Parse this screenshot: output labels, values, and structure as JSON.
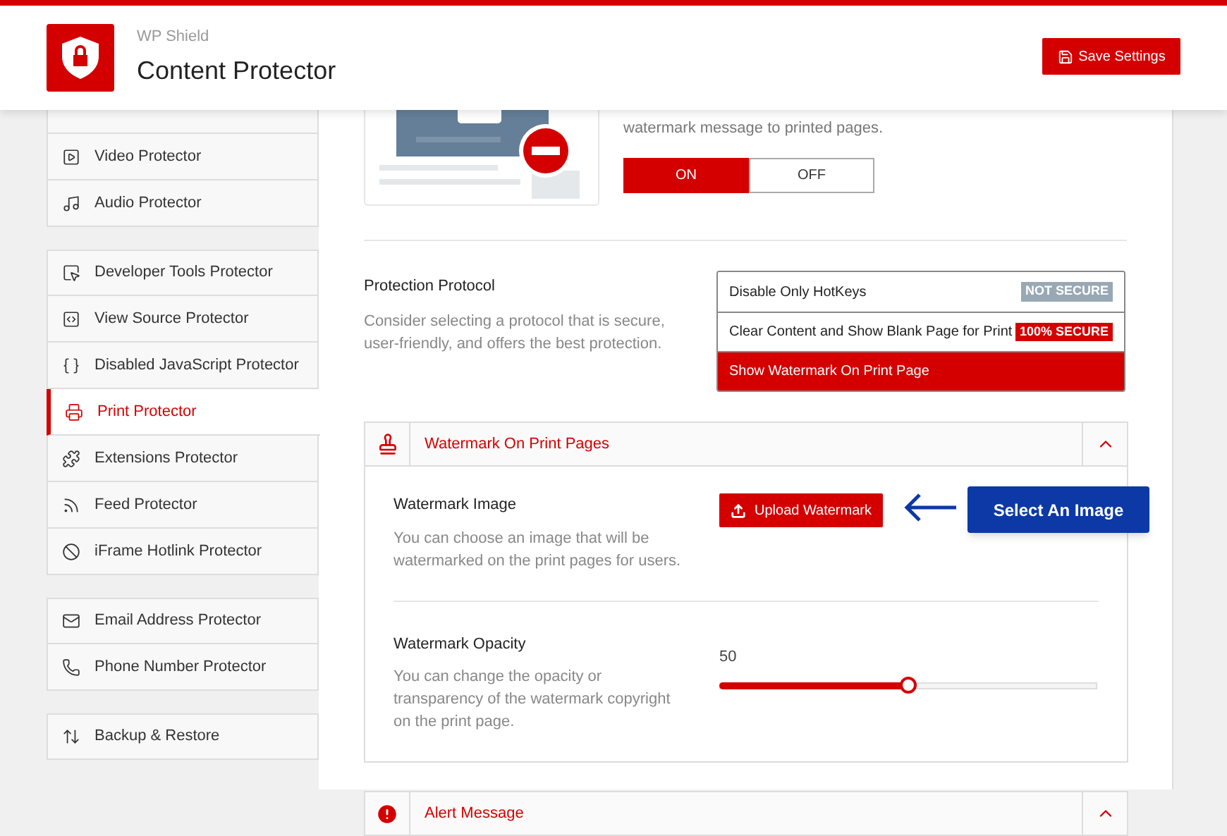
{
  "header": {
    "brand": "WP Shield",
    "title": "Content Protector",
    "save_button": "Save Settings"
  },
  "sidebar": {
    "groups": [
      [
        {
          "label": "Video Protector",
          "selected": false
        },
        {
          "label": "Audio Protector",
          "selected": false
        }
      ],
      [
        {
          "label": "Developer Tools Protector",
          "selected": false
        },
        {
          "label": "View Source Protector",
          "selected": false
        },
        {
          "label": "Disabled JavaScript Protector",
          "selected": false
        },
        {
          "label": "Print Protector",
          "selected": true
        },
        {
          "label": "Extensions Protector",
          "selected": false
        },
        {
          "label": "Feed Protector",
          "selected": false
        },
        {
          "label": "iFrame Hotlink Protector",
          "selected": false
        }
      ],
      [
        {
          "label": "Email Address Protector",
          "selected": false
        },
        {
          "label": "Phone Number Protector",
          "selected": false
        }
      ],
      [
        {
          "label": "Backup & Restore",
          "selected": false
        }
      ]
    ]
  },
  "print_feature": {
    "description": "watermark message to printed pages.",
    "toggle": [
      {
        "label": "ON",
        "selected": true
      },
      {
        "label": "OFF",
        "selected": false
      }
    ]
  },
  "protection_protocol": {
    "title": "Protection Protocol",
    "description": "Consider selecting a protocol that is secure, user-friendly, and offers the best protection.",
    "options": [
      {
        "label": "Disable Only HotKeys",
        "badge": "NOT SECURE",
        "kind": "not-secure",
        "selected": false
      },
      {
        "label": "Clear Content and Show Blank Page for Print",
        "badge": "100% SECURE",
        "kind": "secure",
        "selected": false
      },
      {
        "label": "Show Watermark On Print Page",
        "selected": true
      }
    ]
  },
  "sections": [
    {
      "title": "Watermark On Print Pages",
      "kind": "stamp",
      "expanded": true,
      "settings": [
        {
          "kind": "upload",
          "title": "Watermark Image",
          "description": "You can choose an image that will be watermarked on the print pages for users.",
          "button": "Upload Watermark",
          "callout": "Select An Image"
        },
        {
          "kind": "slider",
          "title": "Watermark Opacity",
          "description": "You can change the opacity or transparency of the watermark copyright on the print page.",
          "value": "50",
          "level": 0.5
        }
      ]
    },
    {
      "title": "Alert Message",
      "kind": "alert",
      "expanded": true
    }
  ]
}
